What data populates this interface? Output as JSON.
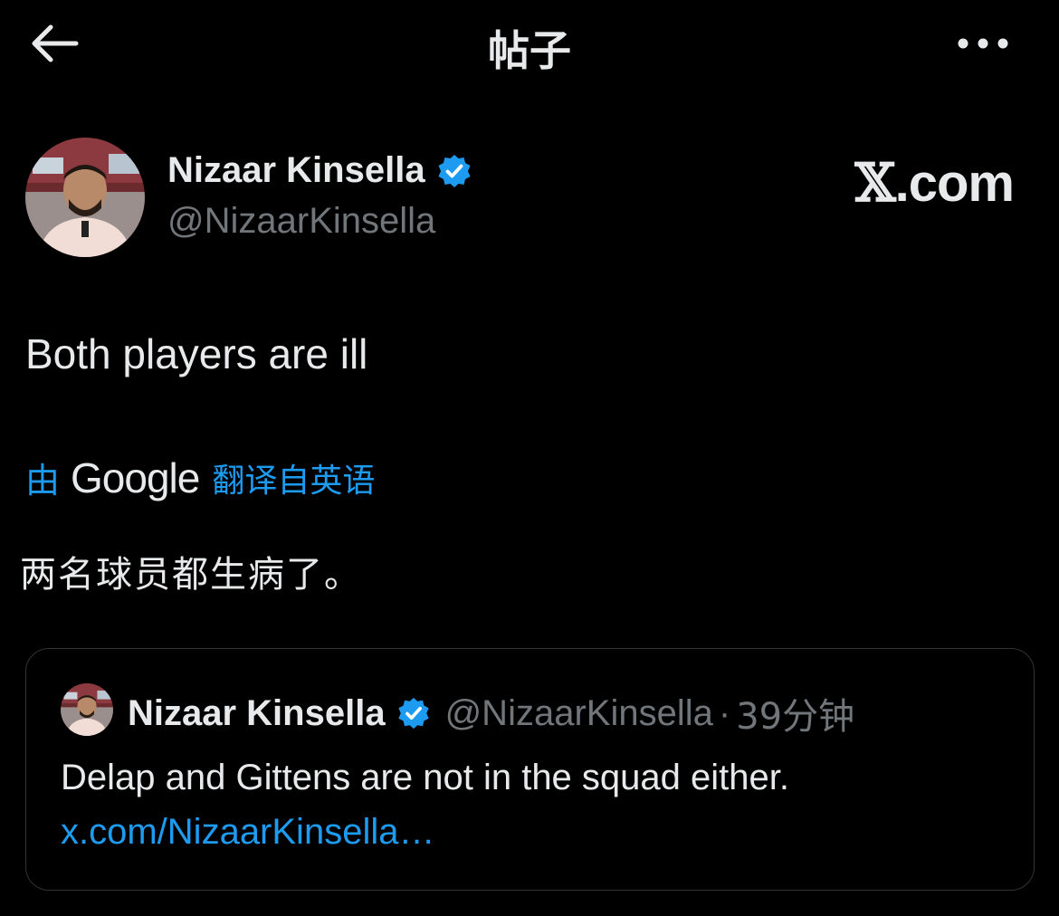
{
  "header": {
    "title": "帖子",
    "back_icon": "arrow-left-icon",
    "more_icon": "more-dots-icon"
  },
  "tweet": {
    "author_name": "Nizaar Kinsella",
    "author_handle": "@NizaarKinsella",
    "verified": true,
    "source_badge_x": "𝕏",
    "source_badge_rest": ".com",
    "text": "Both players are ill",
    "translation": {
      "by_label": "由",
      "provider": "Google",
      "from_label": "翻译自英语",
      "translated_text": "两名球员都生病了。"
    }
  },
  "quoted_tweet": {
    "author_name": "Nizaar Kinsella",
    "author_handle": "@NizaarKinsella",
    "separator": "·",
    "time": "39分钟",
    "verified": true,
    "text": "Delap and Gittens are not in the squad either.",
    "link": "x.com/NizaarKinsella…"
  },
  "colors": {
    "background": "#000000",
    "text_primary": "#e7e9ea",
    "text_secondary": "#71767b",
    "accent": "#1d9bf0",
    "border": "#2f3336"
  }
}
